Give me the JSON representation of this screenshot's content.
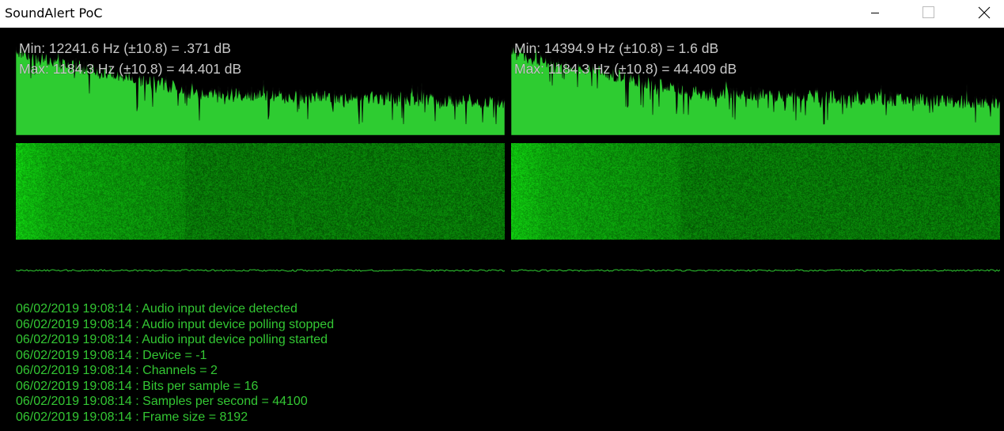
{
  "window": {
    "title": "SoundAlert PoC"
  },
  "colors": {
    "spectrum_fill": "#2ecc31",
    "spectrum_stroke": "#0a0a0a",
    "spectrogram_bright": "#3ce03c",
    "spectrogram_dark": "#0a4a0a",
    "waveform": "#2ecc31",
    "log_text": "#33c733",
    "label_text": "#c8c8c8"
  },
  "channels": [
    {
      "min_label": "Min: 12241.6 Hz (±10.8) = .371 dB",
      "max_label": "Max: 1184.3 Hz (±10.8) = 44.401 dB"
    },
    {
      "min_label": "Min: 14394.9 Hz (±10.8) = 1.6 dB",
      "max_label": "Max: 1184.3 Hz (±10.8) = 44.409 dB"
    }
  ],
  "log": [
    "06/02/2019 19:08:14 : Audio input device detected",
    "06/02/2019 19:08:14 : Audio input device polling stopped",
    "06/02/2019 19:08:14 : Audio input device polling started",
    "06/02/2019 19:08:14 : Device = -1",
    "06/02/2019 19:08:14 : Channels = 2",
    "06/02/2019 19:08:14 : Bits per sample = 16",
    "06/02/2019 19:08:14 : Samples per second = 44100",
    "06/02/2019 19:08:14 : Frame size = 8192"
  ],
  "icons": {
    "minimize": "minimize-icon",
    "maximize": "maximize-icon",
    "close": "close-icon"
  }
}
